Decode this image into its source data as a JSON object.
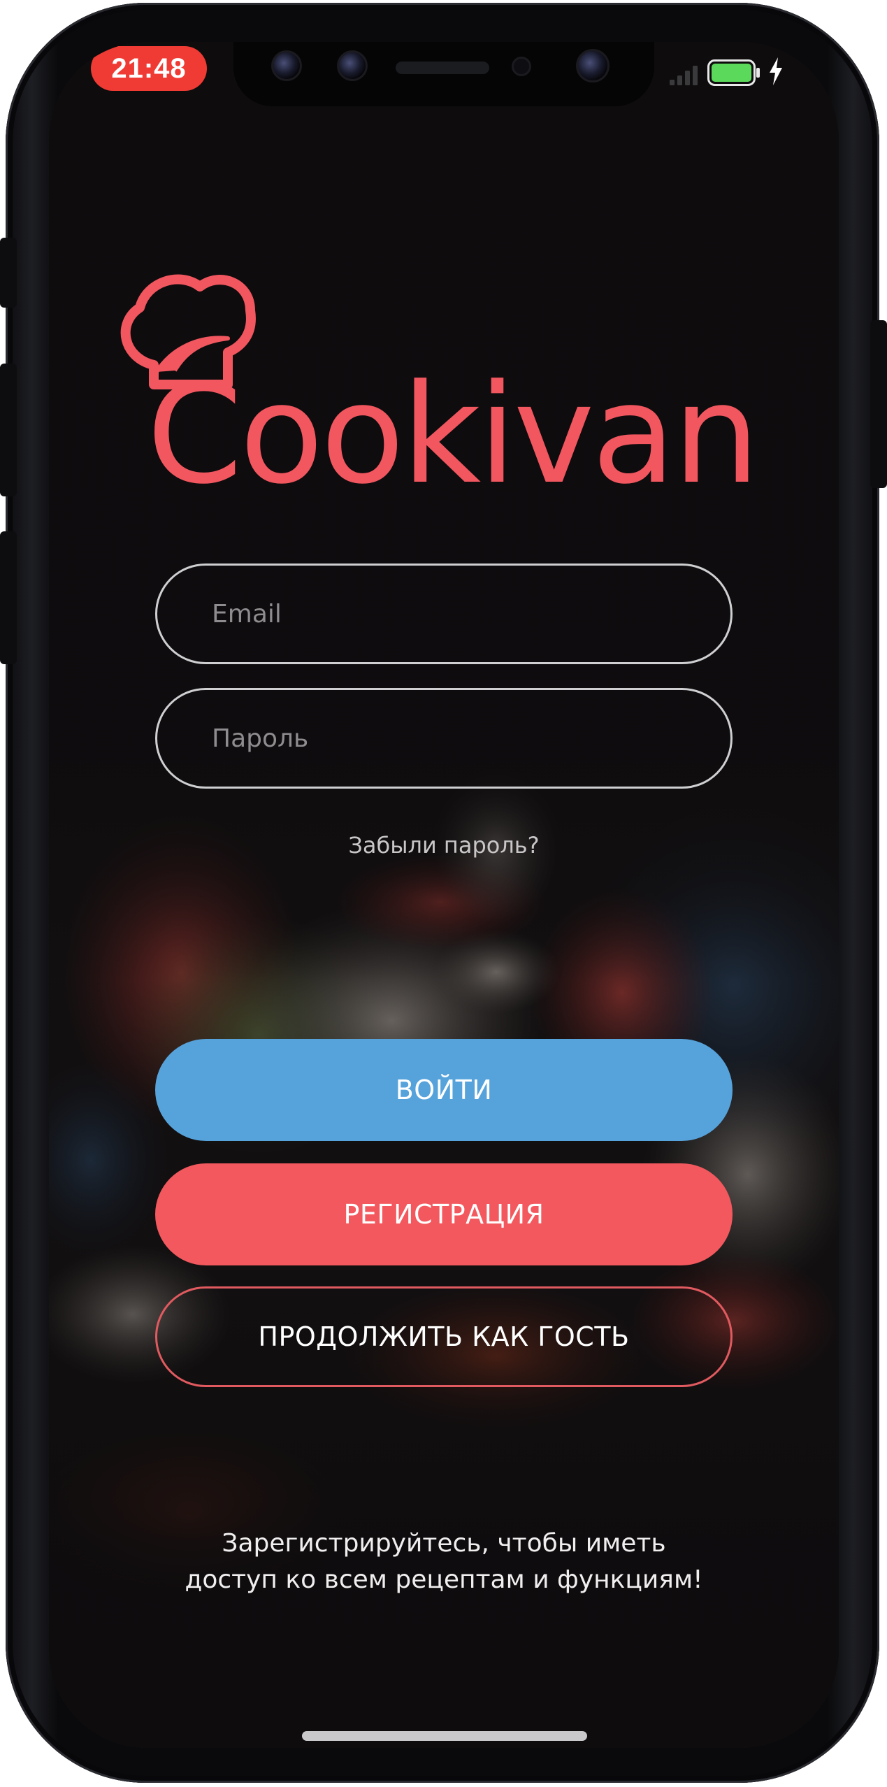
{
  "status_bar": {
    "time": "21:48",
    "time_pill_color": "#ef3b33",
    "battery_color": "#5ad95a",
    "icons": [
      "signal-icon",
      "battery-icon",
      "charging-bolt-icon"
    ]
  },
  "logo": {
    "text": "Cookivan",
    "icon": "chef-hat-icon",
    "color": "#f2565f"
  },
  "login_form": {
    "email_placeholder": "Email",
    "email_value": "",
    "password_placeholder": "Пароль",
    "password_value": "",
    "forgot_password": "Забыли пароль?"
  },
  "actions": {
    "login_label": "ВОЙТИ",
    "login_color": "#56a3dc",
    "register_label": "РЕГИСТРАЦИЯ",
    "register_color": "#f2585d",
    "guest_label": "ПРОДОЛЖИТЬ КАК ГОСТЬ"
  },
  "footer": {
    "line1": "Зарегистрируйтесь, чтобы иметь",
    "line2": "доступ ко всем рецептам и функциям!"
  }
}
